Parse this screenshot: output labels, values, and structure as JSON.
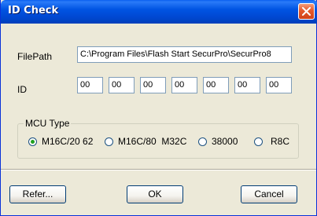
{
  "window": {
    "title": "ID Check"
  },
  "filepath": {
    "label": "FilePath",
    "value": "C:\\Program Files\\Flash Start SecurPro\\SecurPro8"
  },
  "id": {
    "label": "ID",
    "fields": [
      "00",
      "00",
      "00",
      "00",
      "00",
      "00",
      "00"
    ]
  },
  "mcu_type": {
    "label": "MCU Type",
    "options": [
      {
        "label": "M16C/20 62",
        "checked": true
      },
      {
        "label": "M16C/80  M32C",
        "checked": false
      },
      {
        "label": "38000",
        "checked": false
      },
      {
        "label": "R8C",
        "checked": false
      }
    ]
  },
  "buttons": {
    "refer": "Refer...",
    "ok": "OK",
    "cancel": "Cancel"
  },
  "icons": {
    "close": "close-icon"
  }
}
